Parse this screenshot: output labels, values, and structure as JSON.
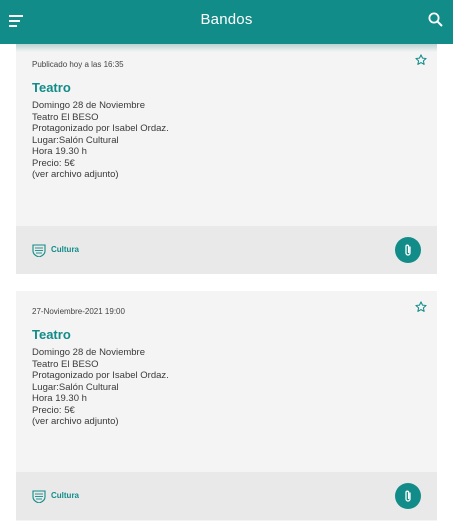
{
  "appbar": {
    "title": "Bandos",
    "menu_icon": "menu-icon",
    "search_icon": "search-icon",
    "color": "#128c89"
  },
  "cards": [
    {
      "date": "Publicado hoy a las 16:35",
      "title": "Teatro",
      "lines": [
        "Domingo 28 de Noviembre",
        "Teatro El BESO",
        "Protagonizado por Isabel Ordaz.",
        "Lugar:Salón Cultural",
        "Hora 19.30 h",
        "Precio: 5€",
        "(ver archivo adjunto)"
      ],
      "category": "Cultura",
      "favorite_icon": "star-outline-icon",
      "attachment_icon": "paperclip-icon"
    },
    {
      "date": "27-Noviembre-2021 19:00",
      "title": "Teatro",
      "lines": [
        "Domingo 28 de Noviembre",
        "Teatro El BESO",
        "Protagonizado por Isabel Ordaz.",
        "Lugar:Salón Cultural",
        "Hora 19.30 h",
        "Precio: 5€",
        "(ver archivo adjunto)"
      ],
      "category": "Cultura",
      "favorite_icon": "star-outline-icon",
      "attachment_icon": "paperclip-icon"
    }
  ]
}
